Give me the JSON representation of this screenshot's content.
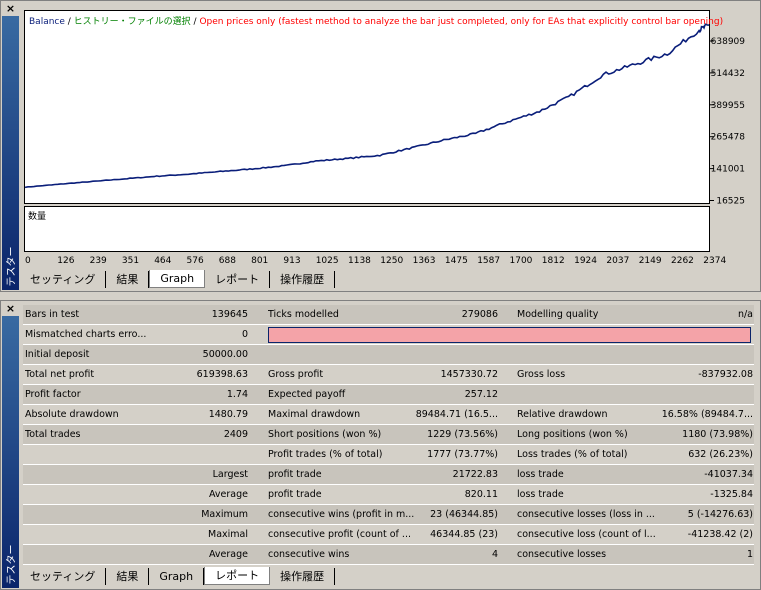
{
  "graph_panel": {
    "side_label": "テスター",
    "legend": {
      "balance": "Balance",
      "sep1": " / ",
      "history": "ヒストリー・ファイルの選択",
      "sep2": " / ",
      "note": "Open prices only (fastest method to analyze the bar just completed, only for EAs that explicitly control bar opening)"
    },
    "volume_label": "数量",
    "tabs": [
      "セッティング",
      "結果",
      "Graph",
      "レポート",
      "操作履歴"
    ],
    "active_tab": "Graph",
    "colors": {
      "balance": "#0a1e7a",
      "dd": "#1fa01f",
      "volume": "#1fa01f",
      "legend_green": "#008000",
      "legend_red": "#ff0000"
    }
  },
  "chart_data": {
    "type": "line",
    "title": "",
    "ylabels": [
      "638909",
      "514432",
      "389955",
      "265478",
      "141001",
      "16525"
    ],
    "xlabels": [
      "0",
      "126",
      "239",
      "351",
      "464",
      "576",
      "688",
      "801",
      "913",
      "1025",
      "1138",
      "1250",
      "1363",
      "1475",
      "1587",
      "1700",
      "1812",
      "1924",
      "2037",
      "2149",
      "2262",
      "2374"
    ],
    "ylim": [
      16525,
      638909
    ],
    "xlim": [
      0,
      2409
    ],
    "series": [
      {
        "values": [
          [
            0,
            50000
          ],
          [
            126,
            62000
          ],
          [
            239,
            72000
          ],
          [
            351,
            82000
          ],
          [
            464,
            92000
          ],
          [
            576,
            100000
          ],
          [
            688,
            110000
          ],
          [
            801,
            120000
          ],
          [
            913,
            132000
          ],
          [
            1025,
            150000
          ],
          [
            1138,
            160000
          ],
          [
            1250,
            172000
          ],
          [
            1363,
            200000
          ],
          [
            1475,
            230000
          ],
          [
            1587,
            255000
          ],
          [
            1700,
            300000
          ],
          [
            1812,
            340000
          ],
          [
            1924,
            400000
          ],
          [
            2037,
            480000
          ],
          [
            2149,
            520000
          ],
          [
            2262,
            560000
          ],
          [
            2374,
            650000
          ],
          [
            2409,
            669398
          ]
        ]
      }
    ]
  },
  "report_panel": {
    "side_label": "テスター",
    "tabs": [
      "セッティング",
      "結果",
      "Graph",
      "レポート",
      "操作履歴"
    ],
    "active_tab": "レポート",
    "rows": [
      {
        "c1": "Bars in test",
        "v1": "139645",
        "c2": "Ticks modelled",
        "v2": "279086",
        "c3": "Modelling quality",
        "v3": "n/a"
      },
      {
        "c1": "Mismatched charts erro...",
        "v1": "0",
        "c2": "",
        "v2": "",
        "c3": "",
        "v3": ""
      },
      {
        "c1": "Initial deposit",
        "v1": "50000.00",
        "c2": "",
        "v2": "",
        "c3": "",
        "v3": ""
      },
      {
        "c1": "Total net profit",
        "v1": "619398.63",
        "c2": "Gross profit",
        "v2": "1457330.72",
        "c3": "Gross loss",
        "v3": "-837932.08"
      },
      {
        "c1": "Profit factor",
        "v1": "1.74",
        "c2": "Expected payoff",
        "v2": "257.12",
        "c3": "",
        "v3": ""
      },
      {
        "c1": "Absolute drawdown",
        "v1": "1480.79",
        "c2": "Maximal drawdown",
        "v2": "89484.71 (16.5...",
        "c3": "Relative drawdown",
        "v3": "16.58% (89484.7..."
      },
      {
        "c1": "Total trades",
        "v1": "2409",
        "c2": "Short positions (won %)",
        "v2": "1229 (73.56%)",
        "c3": "Long positions (won %)",
        "v3": "1180 (73.98%)"
      },
      {
        "c1": "",
        "v1": "",
        "c2": "Profit trades (% of total)",
        "v2": "1777 (73.77%)",
        "c3": "Loss trades (% of total)",
        "v3": "632 (26.23%)"
      },
      {
        "c1": "",
        "v1": "Largest",
        "c2": "profit trade",
        "v2": "21722.83",
        "c3": "loss trade",
        "v3": "-41037.34"
      },
      {
        "c1": "",
        "v1": "Average",
        "c2": "profit trade",
        "v2": "820.11",
        "c3": "loss trade",
        "v3": "-1325.84"
      },
      {
        "c1": "",
        "v1": "Maximum",
        "c2": "consecutive wins (profit in m...",
        "v2": "23 (46344.85)",
        "c3": "consecutive losses (loss in ...",
        "v3": "5 (-14276.63)"
      },
      {
        "c1": "",
        "v1": "Maximal",
        "c2": "consecutive profit (count of ...",
        "v2": "46344.85 (23)",
        "c3": "consecutive loss (count of l...",
        "v3": "-41238.42 (2)"
      },
      {
        "c1": "",
        "v1": "Average",
        "c2": "consecutive wins",
        "v2": "4",
        "c3": "consecutive losses",
        "v3": "1"
      }
    ],
    "colors": {
      "quality_bar": "#f4a3a8",
      "quality_border": "#0a246a"
    }
  }
}
